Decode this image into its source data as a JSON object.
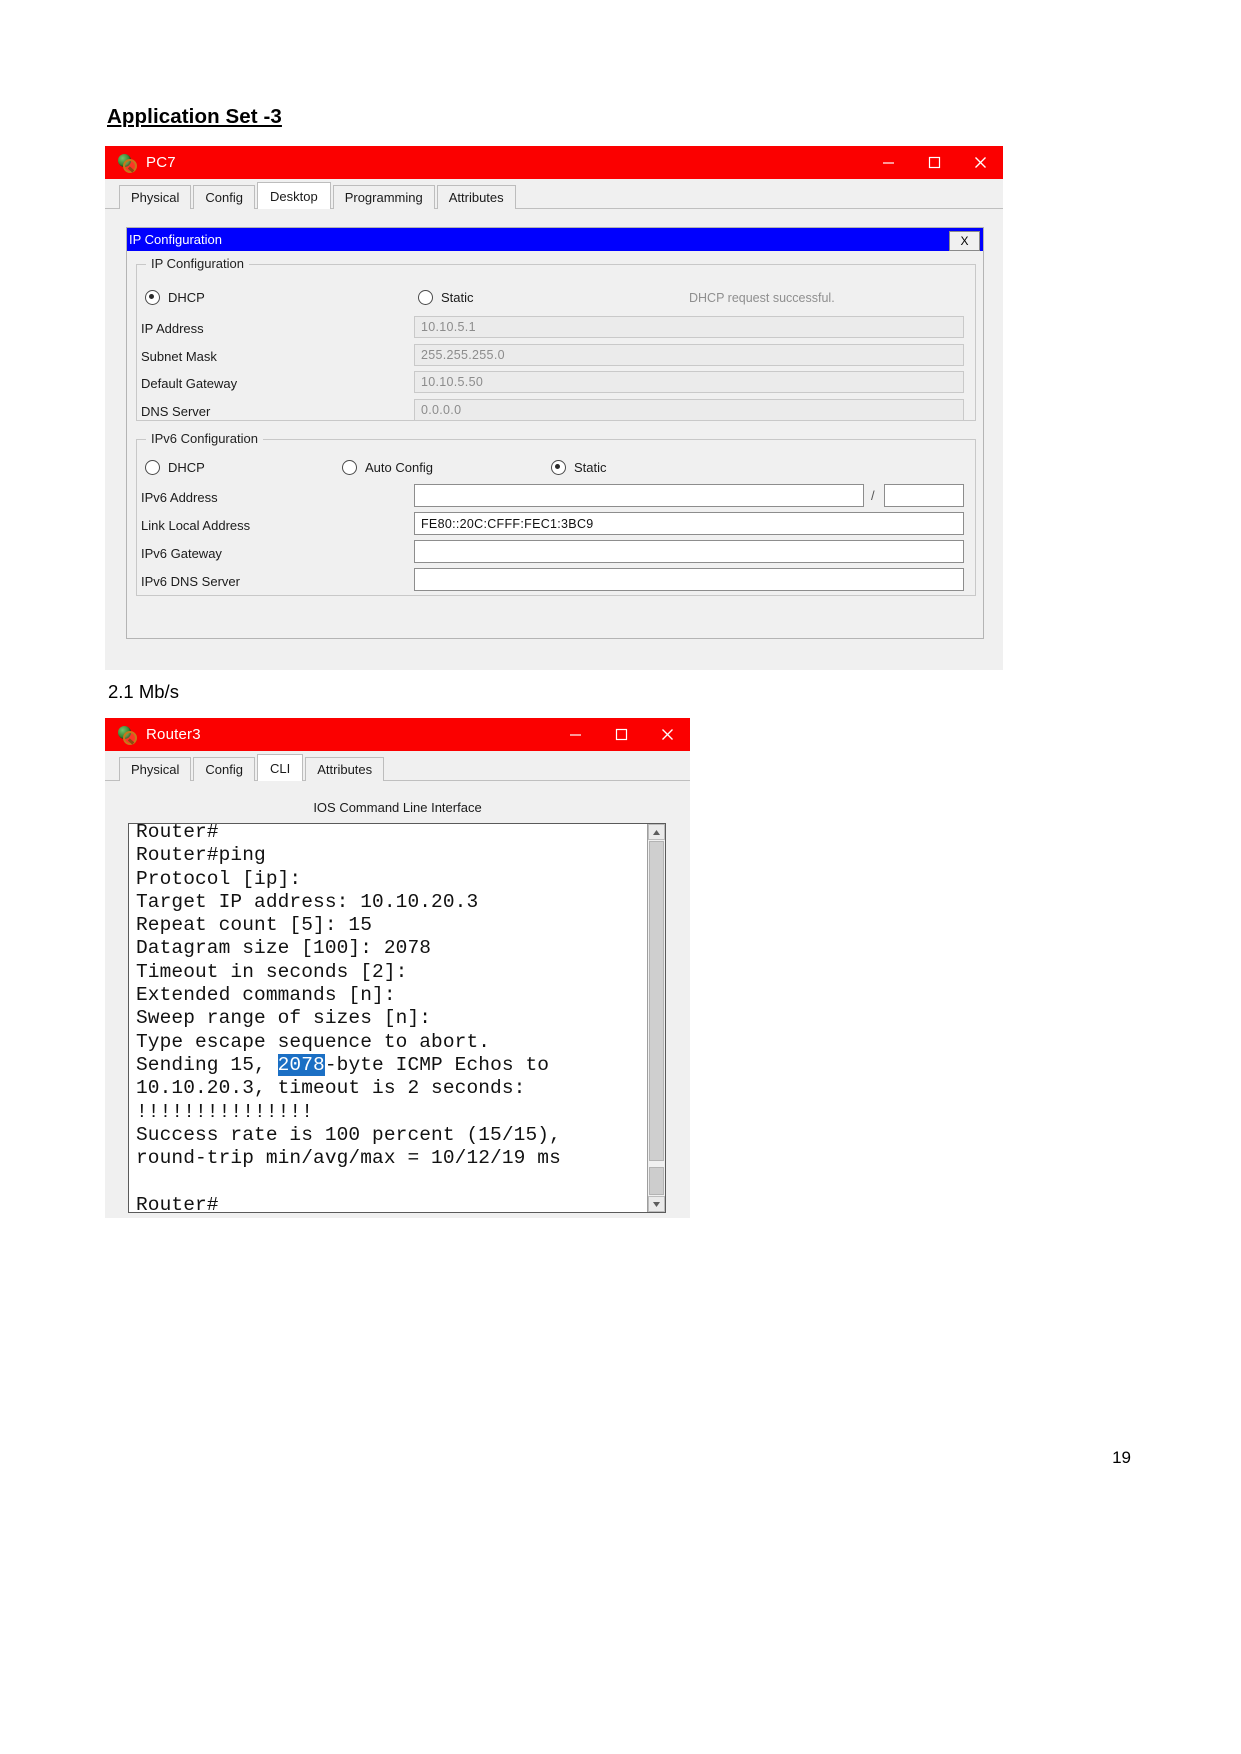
{
  "document": {
    "heading": "Application Set -3",
    "caption": "2.1 Mb/s",
    "page_number": "19"
  },
  "pc_window": {
    "title": "PC7",
    "app_icon": "packet-tracer-icon",
    "window_controls": {
      "minimize": "minimize-icon",
      "maximize": "maximize-icon",
      "close": "close-icon"
    },
    "tabs": [
      {
        "label": "Physical",
        "active": false
      },
      {
        "label": "Config",
        "active": false
      },
      {
        "label": "Desktop",
        "active": true
      },
      {
        "label": "Programming",
        "active": false
      },
      {
        "label": "Attributes",
        "active": false
      }
    ],
    "dialog": {
      "title": "IP Configuration",
      "close_label": "X",
      "ipv4": {
        "legend": "IP Configuration",
        "mode_dhcp": "DHCP",
        "mode_static": "Static",
        "selected_mode": "DHCP",
        "status_message": "DHCP request successful.",
        "fields": [
          {
            "label": "IP Address",
            "value": "10.10.5.1",
            "editable": false
          },
          {
            "label": "Subnet Mask",
            "value": "255.255.255.0",
            "editable": false
          },
          {
            "label": "Default Gateway",
            "value": "10.10.5.50",
            "editable": false
          },
          {
            "label": "DNS Server",
            "value": "0.0.0.0",
            "editable": false
          }
        ]
      },
      "ipv6": {
        "legend": "IPv6 Configuration",
        "mode_dhcp": "DHCP",
        "mode_auto": "Auto Config",
        "mode_static": "Static",
        "selected_mode": "Static",
        "prefix_separator": "/",
        "fields": [
          {
            "label": "IPv6 Address",
            "value": "",
            "editable": true
          },
          {
            "label": "Link Local Address",
            "value": "FE80::20C:CFFF:FEC1:3BC9",
            "editable": true
          },
          {
            "label": "IPv6 Gateway",
            "value": "",
            "editable": true
          },
          {
            "label": "IPv6 DNS Server",
            "value": "",
            "editable": true
          }
        ],
        "prefix_value": ""
      }
    }
  },
  "router_window": {
    "title": "Router3",
    "app_icon": "packet-tracer-icon",
    "window_controls": {
      "minimize": "minimize-icon",
      "maximize": "maximize-icon",
      "close": "close-icon"
    },
    "tabs": [
      {
        "label": "Physical",
        "active": false
      },
      {
        "label": "Config",
        "active": false
      },
      {
        "label": "CLI",
        "active": true
      },
      {
        "label": "Attributes",
        "active": false
      }
    ],
    "cli": {
      "caption": "IOS Command Line Interface",
      "lines_before": "Router#\nRouter#ping\nProtocol [ip]:\nTarget IP address: 10.10.20.3\nRepeat count [5]: 15\nDatagram size [100]: 2078\nTimeout in seconds [2]:\nExtended commands [n]:\nSweep range of sizes [n]:\nType escape sequence to abort.\nSending 15, ",
      "highlight": "2078",
      "lines_after": "-byte ICMP Echos to\n10.10.20.3, timeout is 2 seconds:\n!!!!!!!!!!!!!!!\nSuccess rate is 100 percent (15/15),\nround-trip min/avg/max = 10/12/19 ms\n\nRouter#",
      "scroll_up": "scroll-up-icon",
      "scroll_down": "scroll-down-icon"
    }
  }
}
